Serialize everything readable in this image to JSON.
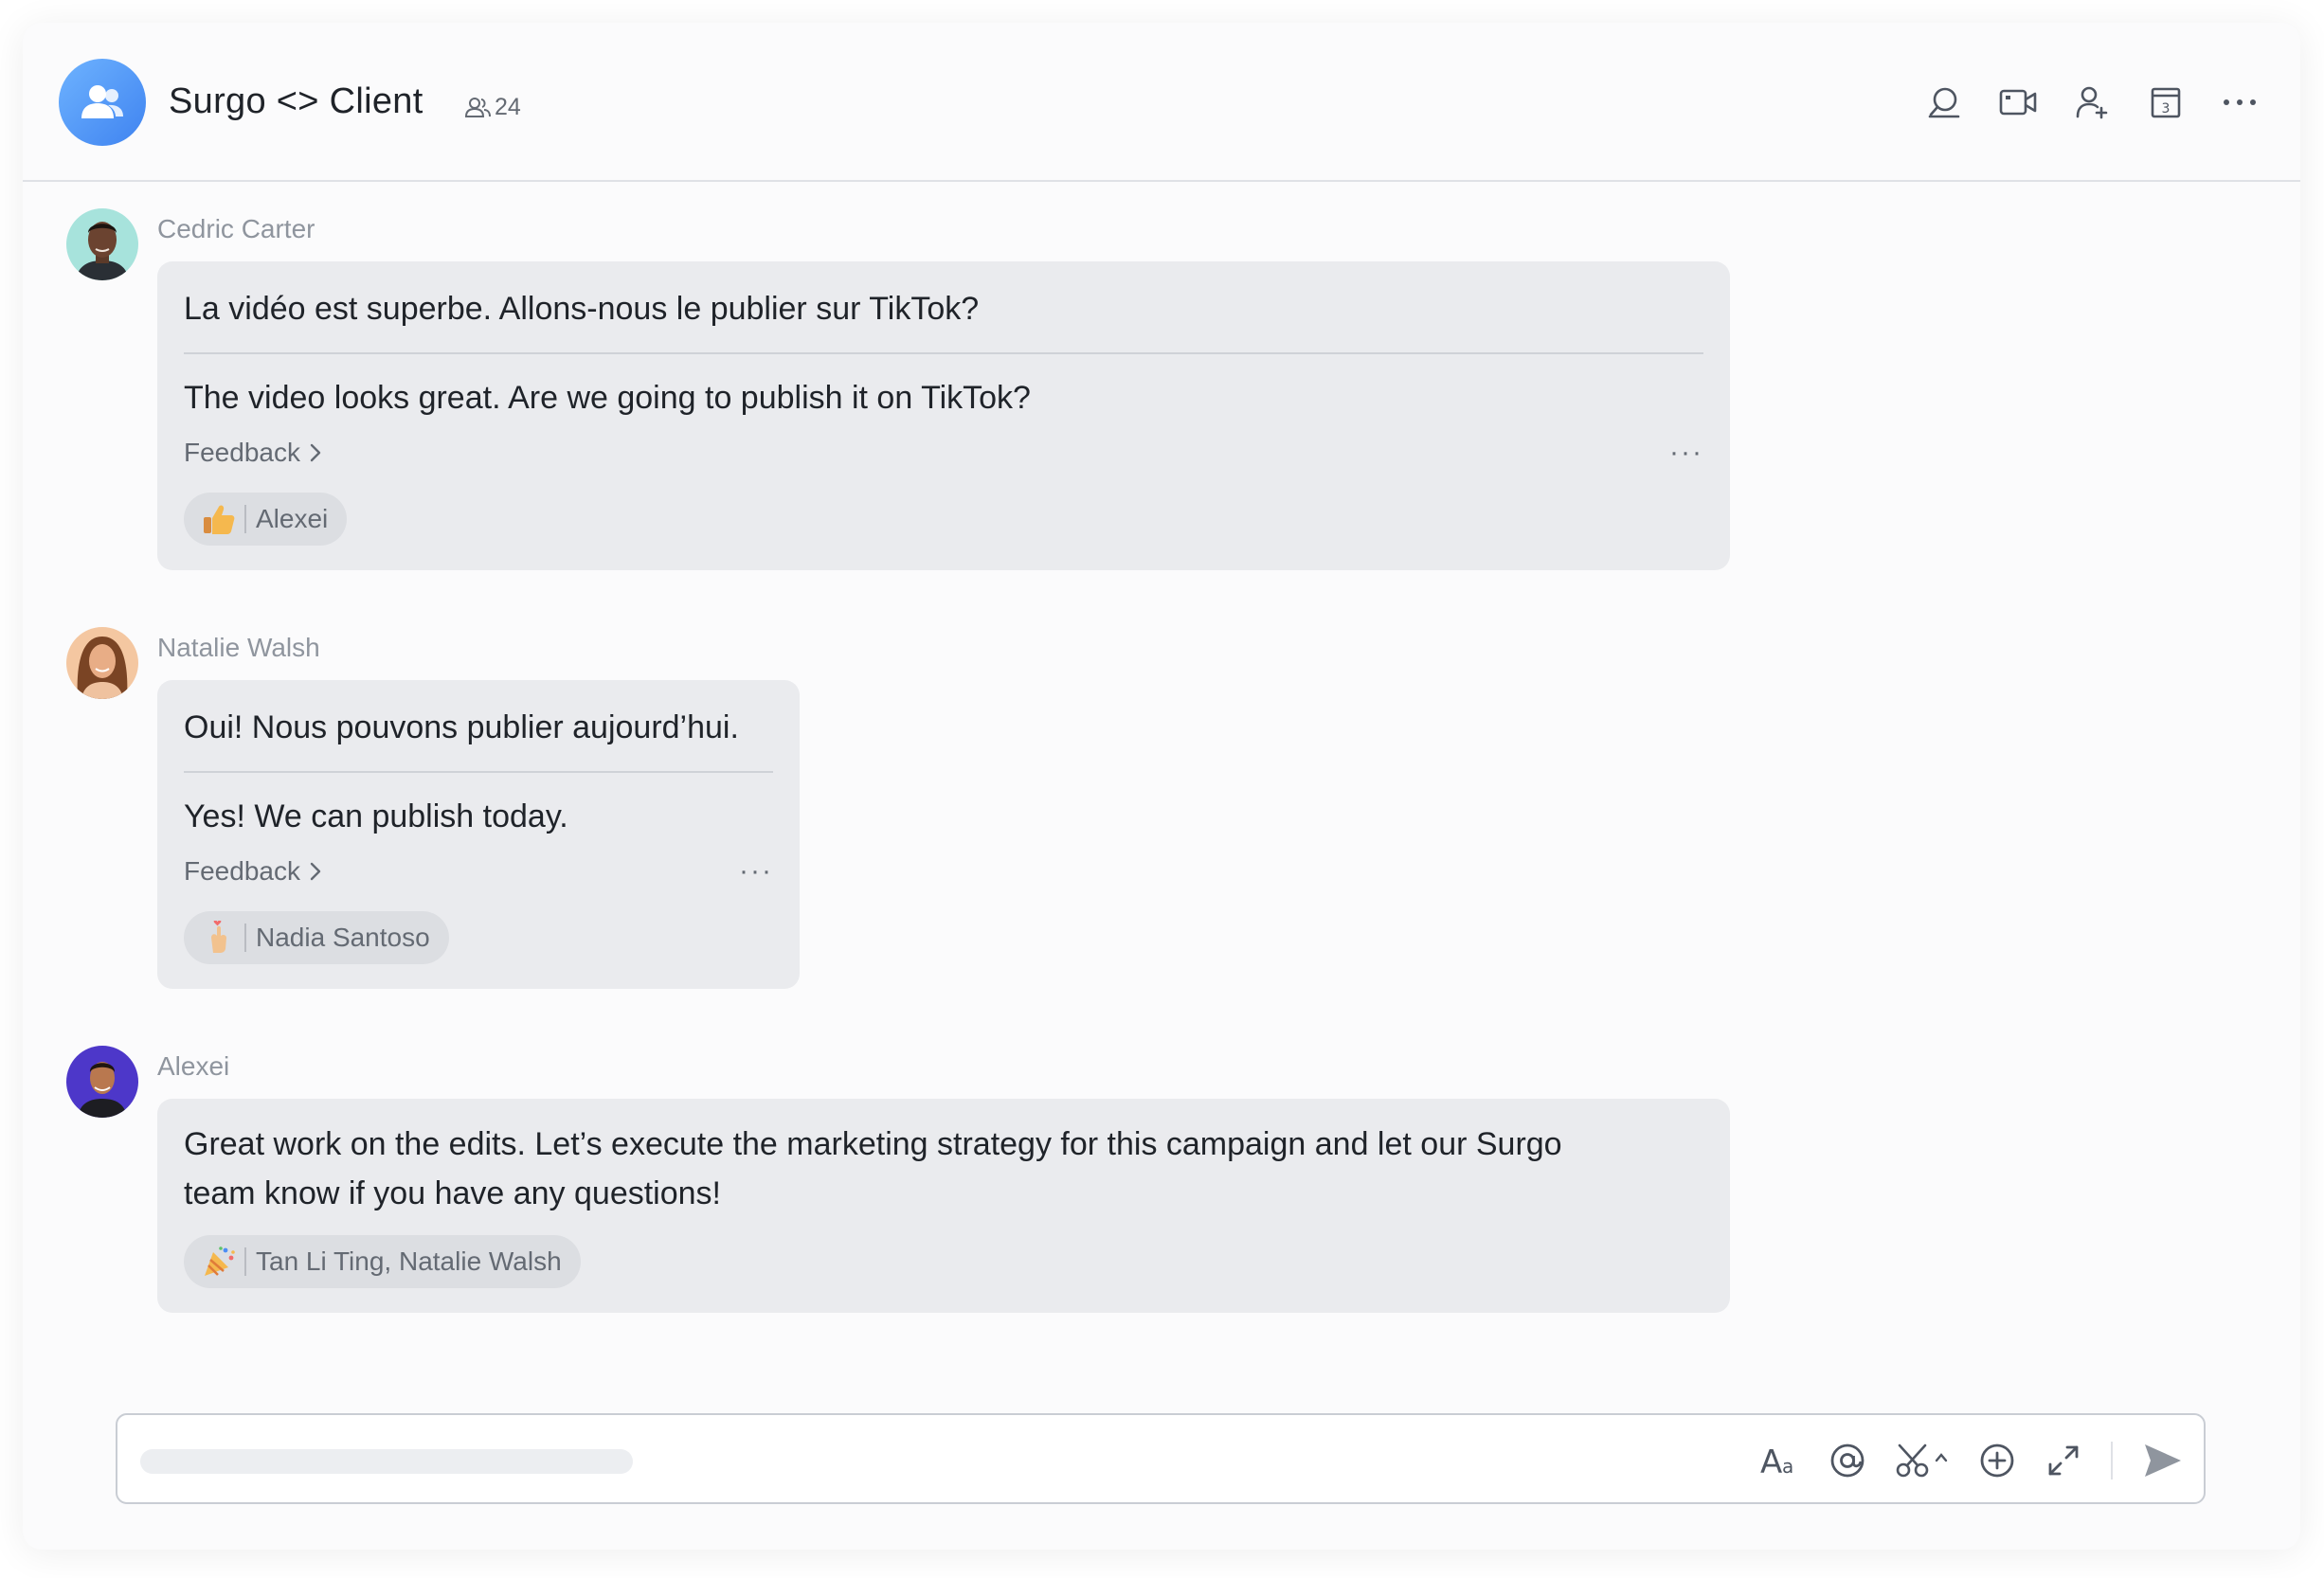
{
  "header": {
    "title": "Surgo <> Client",
    "member_count": "24",
    "actions": [
      "search-icon",
      "video-call-icon",
      "add-member-icon",
      "calendar-icon",
      "more-icon"
    ]
  },
  "messages": [
    {
      "sender": "Cedric Carter",
      "original": "La vidéo est superbe. Allons-nous le publier sur TikTok?",
      "translation": "The video looks great. Are we going to publish it on TikTok?",
      "feedback_label": "Feedback",
      "reaction": {
        "emoji": "thumbs-up",
        "users": "Alexei"
      }
    },
    {
      "sender": "Natalie Walsh",
      "original": "Oui! Nous pouvons publier aujourd’hui.",
      "translation": "Yes! We can publish today.",
      "feedback_label": "Feedback",
      "reaction": {
        "emoji": "finger-heart",
        "users": "Nadia Santoso"
      }
    },
    {
      "sender": "Alexei",
      "lines": [
        "Great work on the edits. Let’s execute the marketing strategy for this campaign and let our Surgo",
        "team know if you have any questions!"
      ],
      "reaction": {
        "emoji": "party-popper",
        "users": "Tan Li Ting, Natalie Walsh"
      }
    }
  ],
  "composer": {
    "tools": [
      "text-format-icon",
      "mention-icon",
      "screenshot-icon",
      "add-icon",
      "expand-icon",
      "send-icon"
    ]
  },
  "colors": {
    "accent_blue": "#3f83f0",
    "bubble": "#eaebee",
    "secondary_text": "#646a73"
  }
}
